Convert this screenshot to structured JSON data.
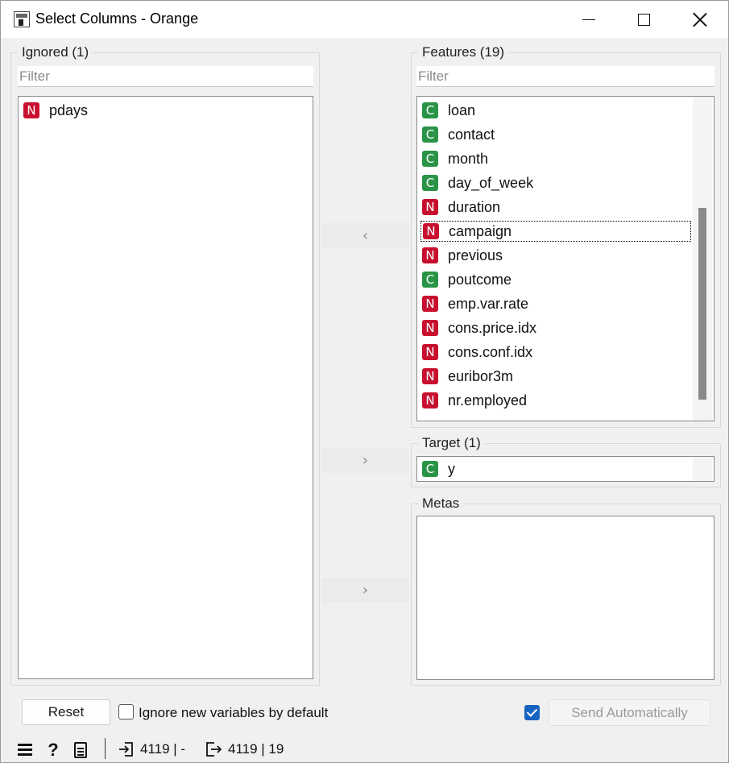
{
  "window": {
    "title": "Select Columns - Orange"
  },
  "ignored": {
    "title": "Ignored (1)",
    "filter_placeholder": "Filter",
    "items": [
      {
        "type": "N",
        "name": "pdays"
      }
    ]
  },
  "features": {
    "title": "Features (19)",
    "filter_placeholder": "Filter",
    "items": [
      {
        "type": "C",
        "name": "loan"
      },
      {
        "type": "C",
        "name": "contact"
      },
      {
        "type": "C",
        "name": "month"
      },
      {
        "type": "C",
        "name": "day_of_week"
      },
      {
        "type": "N",
        "name": "duration"
      },
      {
        "type": "N",
        "name": "campaign",
        "selected": true
      },
      {
        "type": "N",
        "name": "previous"
      },
      {
        "type": "C",
        "name": "poutcome"
      },
      {
        "type": "N",
        "name": "emp.var.rate"
      },
      {
        "type": "N",
        "name": "cons.price.idx"
      },
      {
        "type": "N",
        "name": "cons.conf.idx"
      },
      {
        "type": "N",
        "name": "euribor3m"
      },
      {
        "type": "N",
        "name": "nr.employed"
      }
    ]
  },
  "target": {
    "title": "Target (1)",
    "items": [
      {
        "type": "C",
        "name": "y"
      }
    ]
  },
  "metas": {
    "title": "Metas",
    "items": []
  },
  "arrows": {
    "to_ignored": "‹",
    "to_target": "›",
    "to_metas": "›"
  },
  "controls": {
    "reset_label": "Reset",
    "ignore_new_label": "Ignore new variables by default",
    "ignore_new_checked": false,
    "send_auto_checked": true,
    "send_label": "Send Automatically"
  },
  "status": {
    "input_summary": "4119 | -",
    "output_summary": "4119 | 19"
  },
  "colors": {
    "numeric_badge": "#c8102e",
    "categorical_badge": "#2a9446",
    "accent": "#1565c0"
  }
}
